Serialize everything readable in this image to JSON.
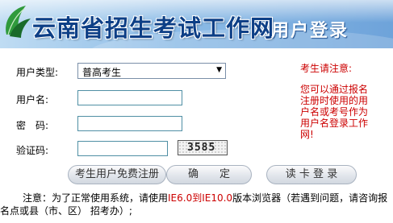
{
  "header": {
    "site_title": "云南省招生考试工作网",
    "page_title": "用户登录"
  },
  "form": {
    "user_type_label": "用户类型:",
    "user_type_value": "普高考生",
    "username_label": "用户名:",
    "password_label": "密　码:",
    "captcha_label": "验证码:",
    "captcha_code": "3585"
  },
  "buttons": {
    "register": "考生用户免费注册",
    "confirm": "确　　定",
    "card_login": "读 卡 登 录"
  },
  "notice": {
    "title": "考生请注意:",
    "text": "您可以通过报名注册时使用的用户名或考号作为用户名登录工作网!"
  },
  "footer": {
    "line1_prefix": "注意：为了正常使用系统，请使用",
    "line1_browser": "IE6.0到IE10.0",
    "line1_suffix": "版本浏览器（若遇到问题，请咨询报",
    "line2": "名点或县（市、区） 招考办）;"
  }
}
